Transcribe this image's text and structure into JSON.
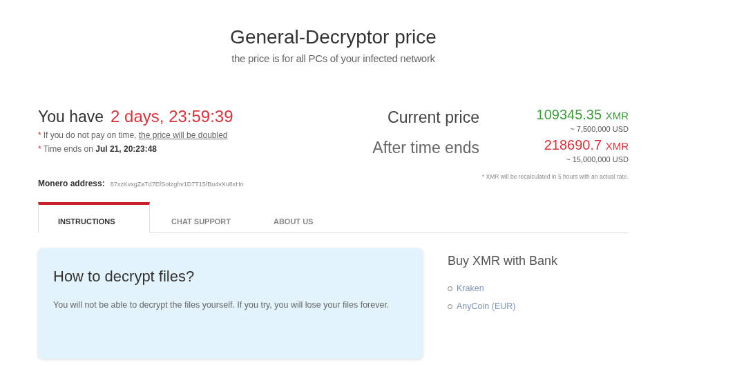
{
  "header": {
    "title": "General-Decryptor price",
    "subtitle": "the price is for all PCs of your infected network"
  },
  "countdown": {
    "label": "You have",
    "value": "2 days, 23:59:39"
  },
  "notes": [
    {
      "marker": "*",
      "text": "If you do not pay on time, ",
      "link": "the price will be doubled"
    },
    {
      "marker": "*",
      "text": "Time ends on **Jul 21, 20:23:48**"
    }
  ],
  "prices": [
    {
      "label": "Current price",
      "amount": "109345.35",
      "unit": "XMR",
      "usd": "~ 7,500,000 USD",
      "color": "#3f9a3f"
    },
    {
      "label": "After time ends",
      "amount": "218690.7",
      "unit": "XMR",
      "usd": "~ 15,000,000 USD",
      "color": "#d2343e"
    }
  ],
  "address": {
    "label": "Monero address:",
    "value": "87xzKvxgZaTd7EfSotzghv1D7T15fBu4vXu8xHri"
  },
  "rate_note": "* XMR will be recalculated in 5 hours with an actual rate.",
  "tabs": [
    {
      "label": "INSTRUCTIONS",
      "selected": true
    },
    {
      "label": "CHAT SUPPORT",
      "selected": false
    },
    {
      "label": "ABOUT US",
      "selected": false
    }
  ],
  "instructions": {
    "title": "How to decrypt files?",
    "text": "You will not be able to decrypt the files yourself. If you try, you will lose your files forever."
  },
  "sidebar": {
    "title": "Buy XMR with Bank",
    "links": [
      "Kraken",
      "AnyCoin (EUR)"
    ]
  }
}
